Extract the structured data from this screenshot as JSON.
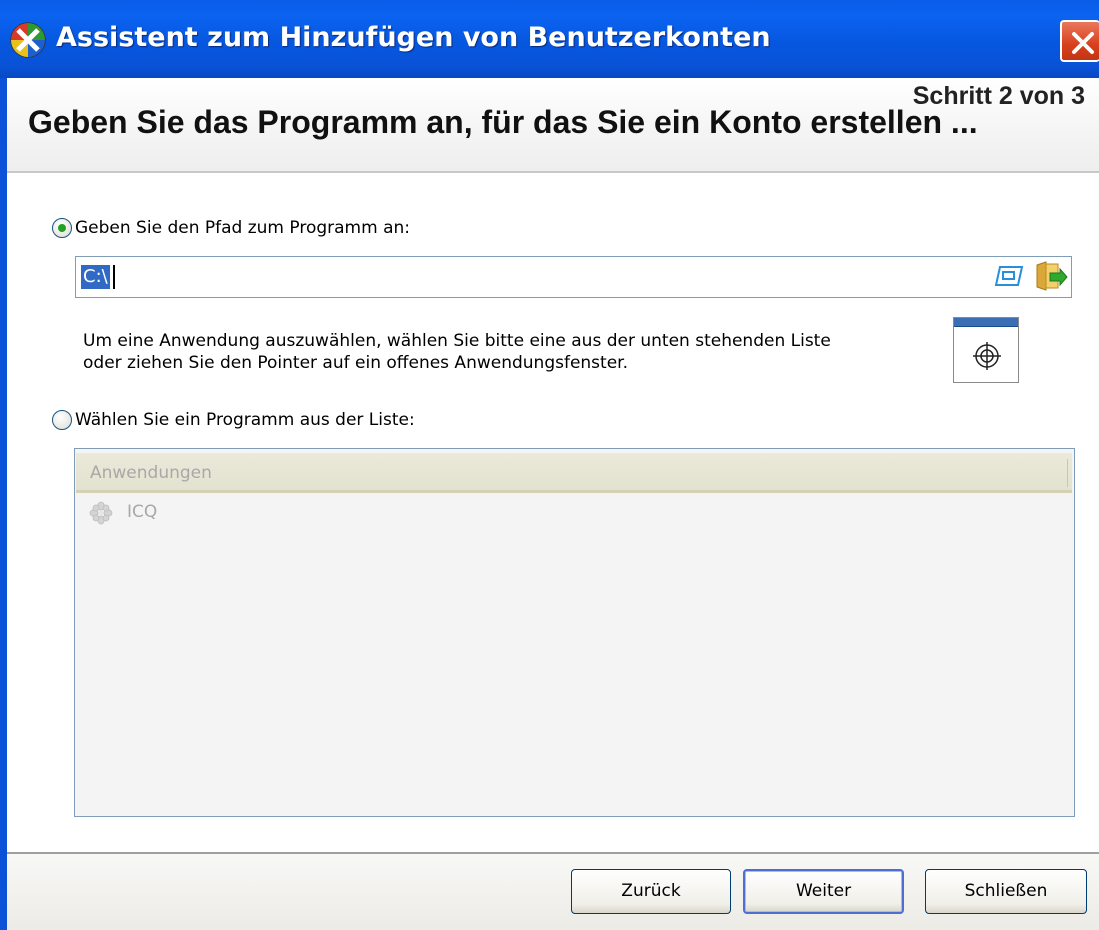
{
  "window": {
    "title": "Assistent zum Hinzufügen von Benutzerkonten"
  },
  "header": {
    "step": "Schritt 2 von 3",
    "heading": "Geben Sie das Programm an, für das Sie ein Konto erstellen ..."
  },
  "path_option": {
    "label": "Geben Sie den Pfad zum Programm an:",
    "selected": true,
    "value": "C:\\"
  },
  "description": {
    "line1": "Um eine Anwendung auszuwählen, wählen Sie bitte eine aus der unten stehenden Liste",
    "line2": "oder ziehen Sie den Pointer auf ein offenes Anwendungsfenster."
  },
  "list_option": {
    "label": "Wählen Sie ein Programm aus der Liste:",
    "selected": false,
    "column_header": "Anwendungen",
    "items": [
      "ICQ"
    ]
  },
  "buttons": {
    "back_accel": "Z",
    "back_rest": "urück",
    "next_accel": "W",
    "next_rest": "eiter",
    "close_accel": "S",
    "close_rest": "chließen"
  },
  "icons": {
    "app": "wizard-icon",
    "close": "close-icon",
    "browse_list": "list-browse-icon",
    "browse_folder": "folder-browse-icon",
    "finder": "crosshair-finder-icon",
    "list_item": "icq-flower-icon"
  },
  "colors": {
    "titlebar": "#0b5de8",
    "selection": "#316ac5",
    "radio_dot": "#21a121"
  }
}
